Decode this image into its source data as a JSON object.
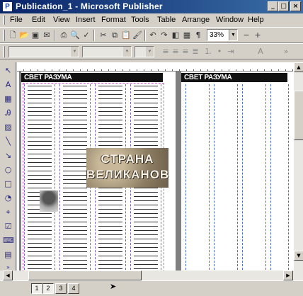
{
  "window": {
    "title": "Publication_1 - Microsoft Publisher",
    "app_icon": "publisher-icon",
    "controls": {
      "minimize": "_",
      "maximize": "□",
      "close": "×"
    }
  },
  "menu": [
    "File",
    "Edit",
    "View",
    "Insert",
    "Format",
    "Tools",
    "Table",
    "Arrange",
    "Window",
    "Help"
  ],
  "standard_toolbar": {
    "icons": [
      "new-icon",
      "open-icon",
      "save-icon",
      "email-icon",
      "print-icon",
      "print-preview-icon",
      "spelling-icon",
      "cut-icon",
      "copy-icon",
      "paste-icon",
      "format-painter-icon",
      "undo-icon",
      "redo-icon",
      "bring-forward-icon",
      "send-backward-icon",
      "insert-table-icon",
      "insert-picture-icon",
      "show-special-characters-icon",
      "zoom-out-icon",
      "zoom-in-icon"
    ],
    "zoom_value": "33%",
    "zoom_out_glyph": "−",
    "zoom_in_glyph": "+"
  },
  "formatting_toolbar": {
    "state": "disabled",
    "icons": [
      "align-left-icon",
      "align-center-icon",
      "align-right-icon",
      "justify-icon",
      "numbering-icon",
      "bullets-icon",
      "indent-icon",
      "font-color-icon",
      "more-buttons-icon"
    ]
  },
  "objects_toolbar": {
    "icons": [
      "select-objects-icon",
      "text-box-icon",
      "table-icon",
      "wordart-icon",
      "picture-frame-icon",
      "line-icon",
      "arrow-icon",
      "oval-icon",
      "rectangle-icon",
      "autoshapes-icon",
      "hot-spot-icon",
      "form-control-icon",
      "html-code-icon",
      "design-gallery-icon",
      "more-buttons-icon"
    ]
  },
  "publication": {
    "header_text_left": "СВЕТ РАЗУМА",
    "header_text_right": "СВЕТ РАЗУМА",
    "logo_line1": "СТРАНА",
    "logo_line2": "ВЕЛИКАНОВ"
  },
  "page_tabs": [
    "1",
    "2",
    "3",
    "4"
  ],
  "active_page": "1",
  "colors": {
    "titlebar_start": "#0a246a",
    "titlebar_end": "#3a6ea5",
    "guide_purple": "#7b62c9",
    "guide_blue": "#4a6bd8",
    "chrome_gray": "#d4d0c8"
  }
}
